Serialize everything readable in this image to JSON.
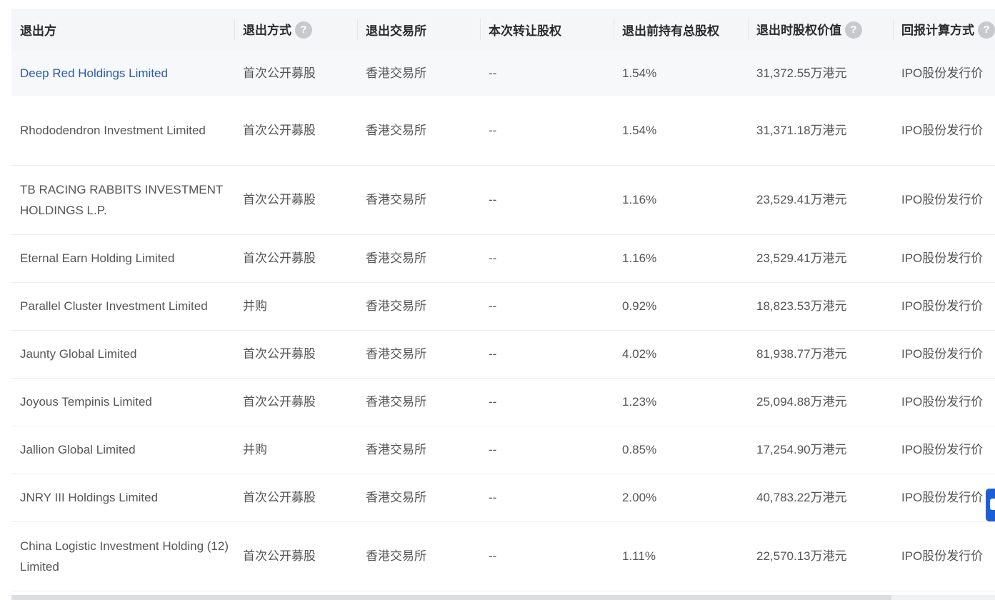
{
  "table": {
    "columns": [
      {
        "label": "退出方",
        "help": false
      },
      {
        "label": "退出方式",
        "help": true
      },
      {
        "label": "退出交易所",
        "help": false
      },
      {
        "label": "本次转让股权",
        "help": false
      },
      {
        "label": "退出前持有总股权",
        "help": false
      },
      {
        "label": "退出时股权价值",
        "help": true
      },
      {
        "label": "回报计算方式",
        "help": true
      }
    ],
    "help_glyph": "?",
    "rows": [
      {
        "party": "Deep Red Holdings Limited",
        "method": "首次公开募股",
        "exchange": "香港交易所",
        "transfer": "--",
        "held": "1.54%",
        "value": "31,372.55万港元",
        "calc": "IPO股份发行价"
      },
      {
        "party": "Rhododendron Investment Limited",
        "method": "首次公开募股",
        "exchange": "香港交易所",
        "transfer": "--",
        "held": "1.54%",
        "value": "31,371.18万港元",
        "calc": "IPO股份发行价"
      },
      {
        "party": "TB RACING RABBITS INVESTMENT HOLDINGS L.P.",
        "method": "首次公开募股",
        "exchange": "香港交易所",
        "transfer": "--",
        "held": "1.16%",
        "value": "23,529.41万港元",
        "calc": "IPO股份发行价"
      },
      {
        "party": "Eternal Earn Holding Limited",
        "method": "首次公开募股",
        "exchange": "香港交易所",
        "transfer": "--",
        "held": "1.16%",
        "value": "23,529.41万港元",
        "calc": "IPO股份发行价"
      },
      {
        "party": "Parallel Cluster Investment Limited",
        "method": "并购",
        "exchange": "香港交易所",
        "transfer": "--",
        "held": "0.92%",
        "value": "18,823.53万港元",
        "calc": "IPO股份发行价"
      },
      {
        "party": "Jaunty Global Limited",
        "method": "首次公开募股",
        "exchange": "香港交易所",
        "transfer": "--",
        "held": "4.02%",
        "value": "81,938.77万港元",
        "calc": "IPO股份发行价"
      },
      {
        "party": "Joyous Tempinis Limited",
        "method": "首次公开募股",
        "exchange": "香港交易所",
        "transfer": "--",
        "held": "1.23%",
        "value": "25,094.88万港元",
        "calc": "IPO股份发行价"
      },
      {
        "party": "Jallion Global Limited",
        "method": "并购",
        "exchange": "香港交易所",
        "transfer": "--",
        "held": "0.85%",
        "value": "17,254.90万港元",
        "calc": "IPO股份发行价"
      },
      {
        "party": "JNRY III Holdings Limited",
        "method": "首次公开募股",
        "exchange": "香港交易所",
        "transfer": "--",
        "held": "2.00%",
        "value": "40,783.22万港元",
        "calc": "IPO股份发行价"
      },
      {
        "party": "China Logistic Investment Holding (12) Limited",
        "method": "首次公开募股",
        "exchange": "香港交易所",
        "transfer": "--",
        "held": "1.11%",
        "value": "22,570.13万港元",
        "calc": "IPO股份发行价"
      }
    ]
  },
  "colors": {
    "link": "#2b5ba8",
    "text": "#555555",
    "header_bg": "#f5f6f8",
    "float_button": "#1b5ed8"
  }
}
